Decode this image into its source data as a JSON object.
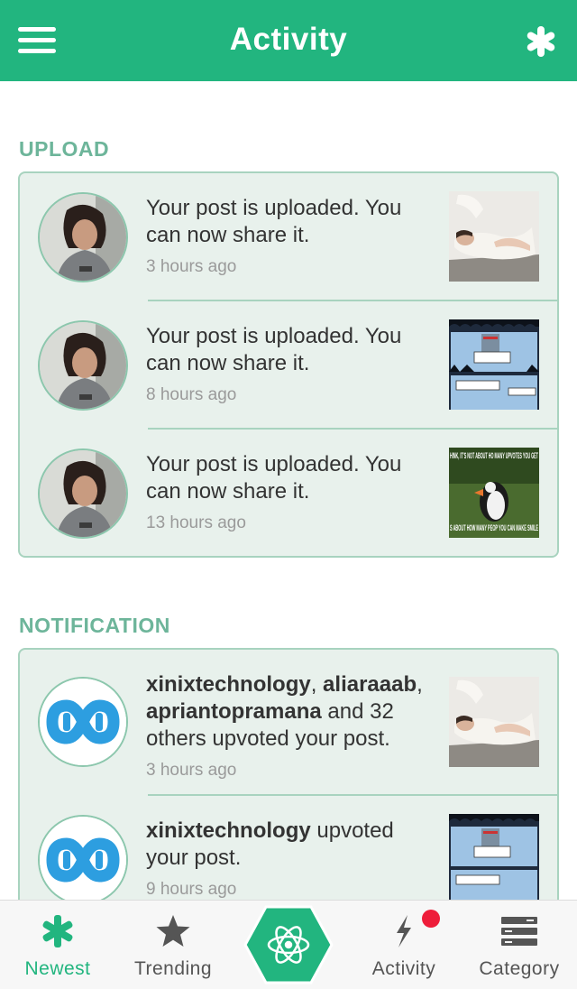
{
  "header": {
    "title": "Activity",
    "menu_icon": "hamburger-menu-icon",
    "action_icon": "asterisk-icon",
    "background": "#22b57f"
  },
  "upload": {
    "label": "UPLOAD",
    "items": [
      {
        "message": "Your post is uploaded. You can now share it.",
        "time": "3 hours ago",
        "thumb": "woman-reclining-photo"
      },
      {
        "message": "Your post is uploaded. You can now share it.",
        "time": "8 hours ago",
        "thumb": "comic-strip"
      },
      {
        "message": "Your post is uploaded. You can now share it.",
        "time": "13 hours ago",
        "thumb": "puffin-meme"
      }
    ]
  },
  "meme": {
    "top": "HINK, IT'S NOT ABOUT HO MANY UPVOTES YOU GET",
    "bottom": "S ABOUT HOW MANY PEOP YOU CAN MAKE SMILE"
  },
  "notification": {
    "label": "NOTIFICATION",
    "items": [
      {
        "user1": "xinixtechnology",
        "sep1": ", ",
        "user2": "aliaraaab",
        "sep2": ",",
        "user3": "apriantopramana",
        "rest": " and 32 others upvoted your post.",
        "time": "3 hours ago"
      },
      {
        "user1": "xinixtechnology",
        "rest": " upvoted your post.",
        "time": "9 hours ago"
      }
    ]
  },
  "nav": {
    "items": [
      {
        "label": "Newest",
        "icon": "asterisk-icon",
        "active": true
      },
      {
        "label": "Trending",
        "icon": "star-icon",
        "active": false
      },
      {
        "label": "",
        "icon": "atom-icon",
        "active": false
      },
      {
        "label": "Activity",
        "icon": "lightning-icon",
        "active": false
      },
      {
        "label": "Category",
        "icon": "server-stack-icon",
        "active": false
      }
    ],
    "active_color": "#22b57f",
    "badge_color": "#ee1d3a"
  }
}
